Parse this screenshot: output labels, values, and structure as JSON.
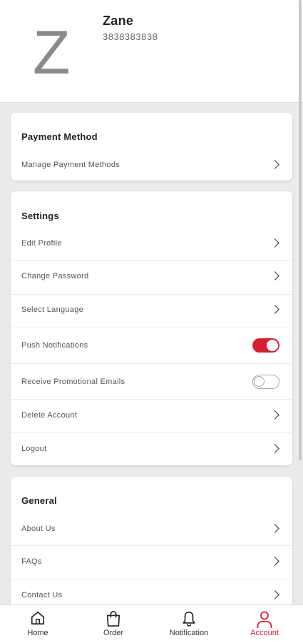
{
  "profile": {
    "initial": "Z",
    "name": "Zane",
    "phone": "3838383838"
  },
  "payment": {
    "title": "Payment Method",
    "items": [
      {
        "label": "Manage Payment Methods"
      }
    ]
  },
  "settings": {
    "title": "Settings",
    "items": [
      {
        "label": "Edit Profile",
        "type": "link"
      },
      {
        "label": "Change Password",
        "type": "link"
      },
      {
        "label": "Select Language",
        "type": "link"
      },
      {
        "label": "Push Notifications",
        "type": "toggle",
        "on": true
      },
      {
        "label": "Receive Promotional Emails",
        "type": "toggle",
        "on": false
      },
      {
        "label": "Delete Account",
        "type": "link"
      },
      {
        "label": "Logout",
        "type": "link"
      }
    ]
  },
  "general": {
    "title": "General",
    "items": [
      {
        "label": "About Us"
      },
      {
        "label": "FAQs"
      },
      {
        "label": "Contact Us"
      }
    ]
  },
  "tabs": [
    {
      "label": "Home",
      "icon": "home-icon"
    },
    {
      "label": "Order",
      "icon": "shopping-bag-icon"
    },
    {
      "label": "Notification",
      "icon": "bell-icon"
    },
    {
      "label": "Account",
      "icon": "user-icon",
      "active": true
    }
  ],
  "colors": {
    "accent": "#d91f2e",
    "background": "#ebebeb"
  }
}
